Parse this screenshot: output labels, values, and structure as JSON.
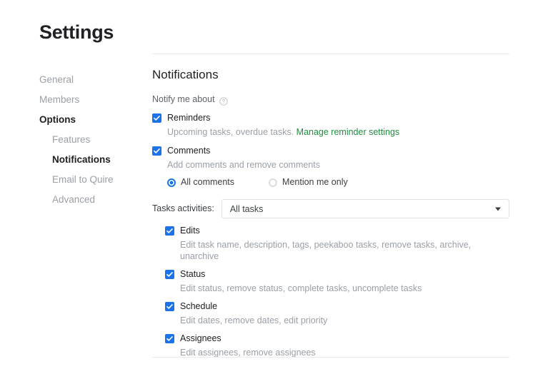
{
  "page": {
    "title": "Settings"
  },
  "sidebar": {
    "items": [
      {
        "label": "General",
        "level": 0,
        "active": false
      },
      {
        "label": "Members",
        "level": 0,
        "active": false
      },
      {
        "label": "Options",
        "level": 0,
        "active": true
      },
      {
        "label": "Features",
        "level": 1,
        "active": false
      },
      {
        "label": "Notifications",
        "level": 1,
        "active": true
      },
      {
        "label": "Email to Quire",
        "level": 1,
        "active": false
      },
      {
        "label": "Advanced",
        "level": 1,
        "active": false
      }
    ]
  },
  "main": {
    "section_title": "Notifications",
    "notify_label": "Notify me about",
    "help_icon": "help-circle-icon",
    "reminders": {
      "label": "Reminders",
      "checked": true,
      "description": "Upcoming tasks, overdue tasks.",
      "link_label": "Manage reminder settings",
      "link_color": "#1e8e3e"
    },
    "comments": {
      "label": "Comments",
      "checked": true,
      "description": "Add comments and remove comments",
      "options": [
        {
          "label": "All comments",
          "selected": true
        },
        {
          "label": "Mention me only",
          "selected": false
        }
      ]
    },
    "tasks_activities": {
      "caption": "Tasks activities:",
      "selected": "All tasks",
      "arrow_icon": "chevron-down-icon",
      "items": [
        {
          "label": "Edits",
          "checked": true,
          "description": "Edit task name, description, tags, peekaboo tasks, remove tasks, archive, unarchive"
        },
        {
          "label": "Status",
          "checked": true,
          "description": "Edit status, remove status, complete tasks, uncomplete tasks"
        },
        {
          "label": "Schedule",
          "checked": true,
          "description": "Edit dates, remove dates, edit priority"
        },
        {
          "label": "Assignees",
          "checked": true,
          "description": "Edit assignees, remove assignees"
        }
      ]
    }
  },
  "theme": {
    "checkbox_blue": "#1a73e8",
    "radio_blue": "#1a73e8",
    "link_green": "#1e8e3e",
    "muted_text": "#9aa0a6",
    "divider": "#e8eaed"
  }
}
